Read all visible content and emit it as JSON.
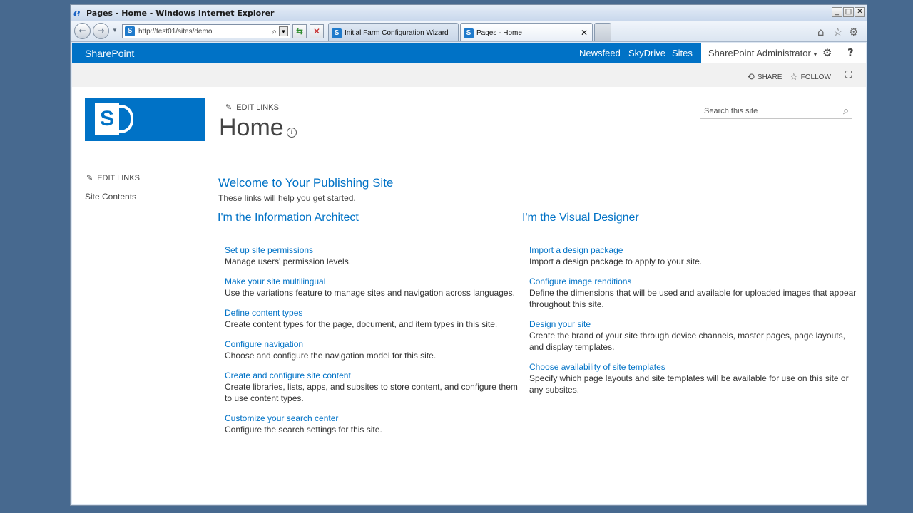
{
  "window": {
    "title": "Pages - Home - Windows Internet Explorer",
    "controls": {
      "minimize": "_",
      "maximize": "□",
      "close": "✕"
    }
  },
  "browser": {
    "address": "http://test01/sites/demo",
    "tabs": [
      {
        "label": "Initial Farm Configuration Wizard"
      },
      {
        "label": "Pages - Home"
      }
    ]
  },
  "suite_bar": {
    "brand": "SharePoint",
    "links": [
      "Newsfeed",
      "SkyDrive",
      "Sites"
    ],
    "user": "SharePoint Administrator"
  },
  "ribbon": {
    "share": "SHARE",
    "follow": "FOLLOW"
  },
  "header": {
    "edit_links": "EDIT LINKS",
    "page_title": "Home",
    "search_placeholder": "Search this site"
  },
  "left_nav": {
    "edit_links": "EDIT LINKS",
    "items": [
      "Site Contents"
    ]
  },
  "main": {
    "welcome_title": "Welcome to Your Publishing Site",
    "welcome_subtitle": "These links will help you get started.",
    "columns": [
      {
        "heading": "I'm the Information Architect",
        "entries": [
          {
            "link": "Set up site permissions",
            "desc": "Manage users' permission levels."
          },
          {
            "link": "Make your site multilingual",
            "desc": "Use the variations feature to manage sites and navigation across languages."
          },
          {
            "link": "Define content types",
            "desc": "Create content types for the page, document, and item types in this site."
          },
          {
            "link": "Configure navigation",
            "desc": "Choose and configure the navigation model for this site."
          },
          {
            "link": "Create and configure site content",
            "desc": "Create libraries, lists, apps, and subsites to store content, and configure them to use content types."
          },
          {
            "link": "Customize your search center",
            "desc": "Configure the search settings for this site."
          }
        ]
      },
      {
        "heading": "I'm the Visual Designer",
        "entries": [
          {
            "link": "Import a design package",
            "desc": "Import a design package to apply to your site."
          },
          {
            "link": "Configure image renditions",
            "desc": "Define the dimensions that will be used and available for uploaded images that appear throughout this site."
          },
          {
            "link": "Design your site",
            "desc": "Create the brand of your site through device channels, master pages, page layouts, and display templates."
          },
          {
            "link": "Choose availability of site templates",
            "desc": "Specify which page layouts and site templates will be available for use on this site or any subsites."
          }
        ]
      }
    ]
  },
  "colors": {
    "accent": "#0072c6",
    "desktop": "#47698f"
  }
}
